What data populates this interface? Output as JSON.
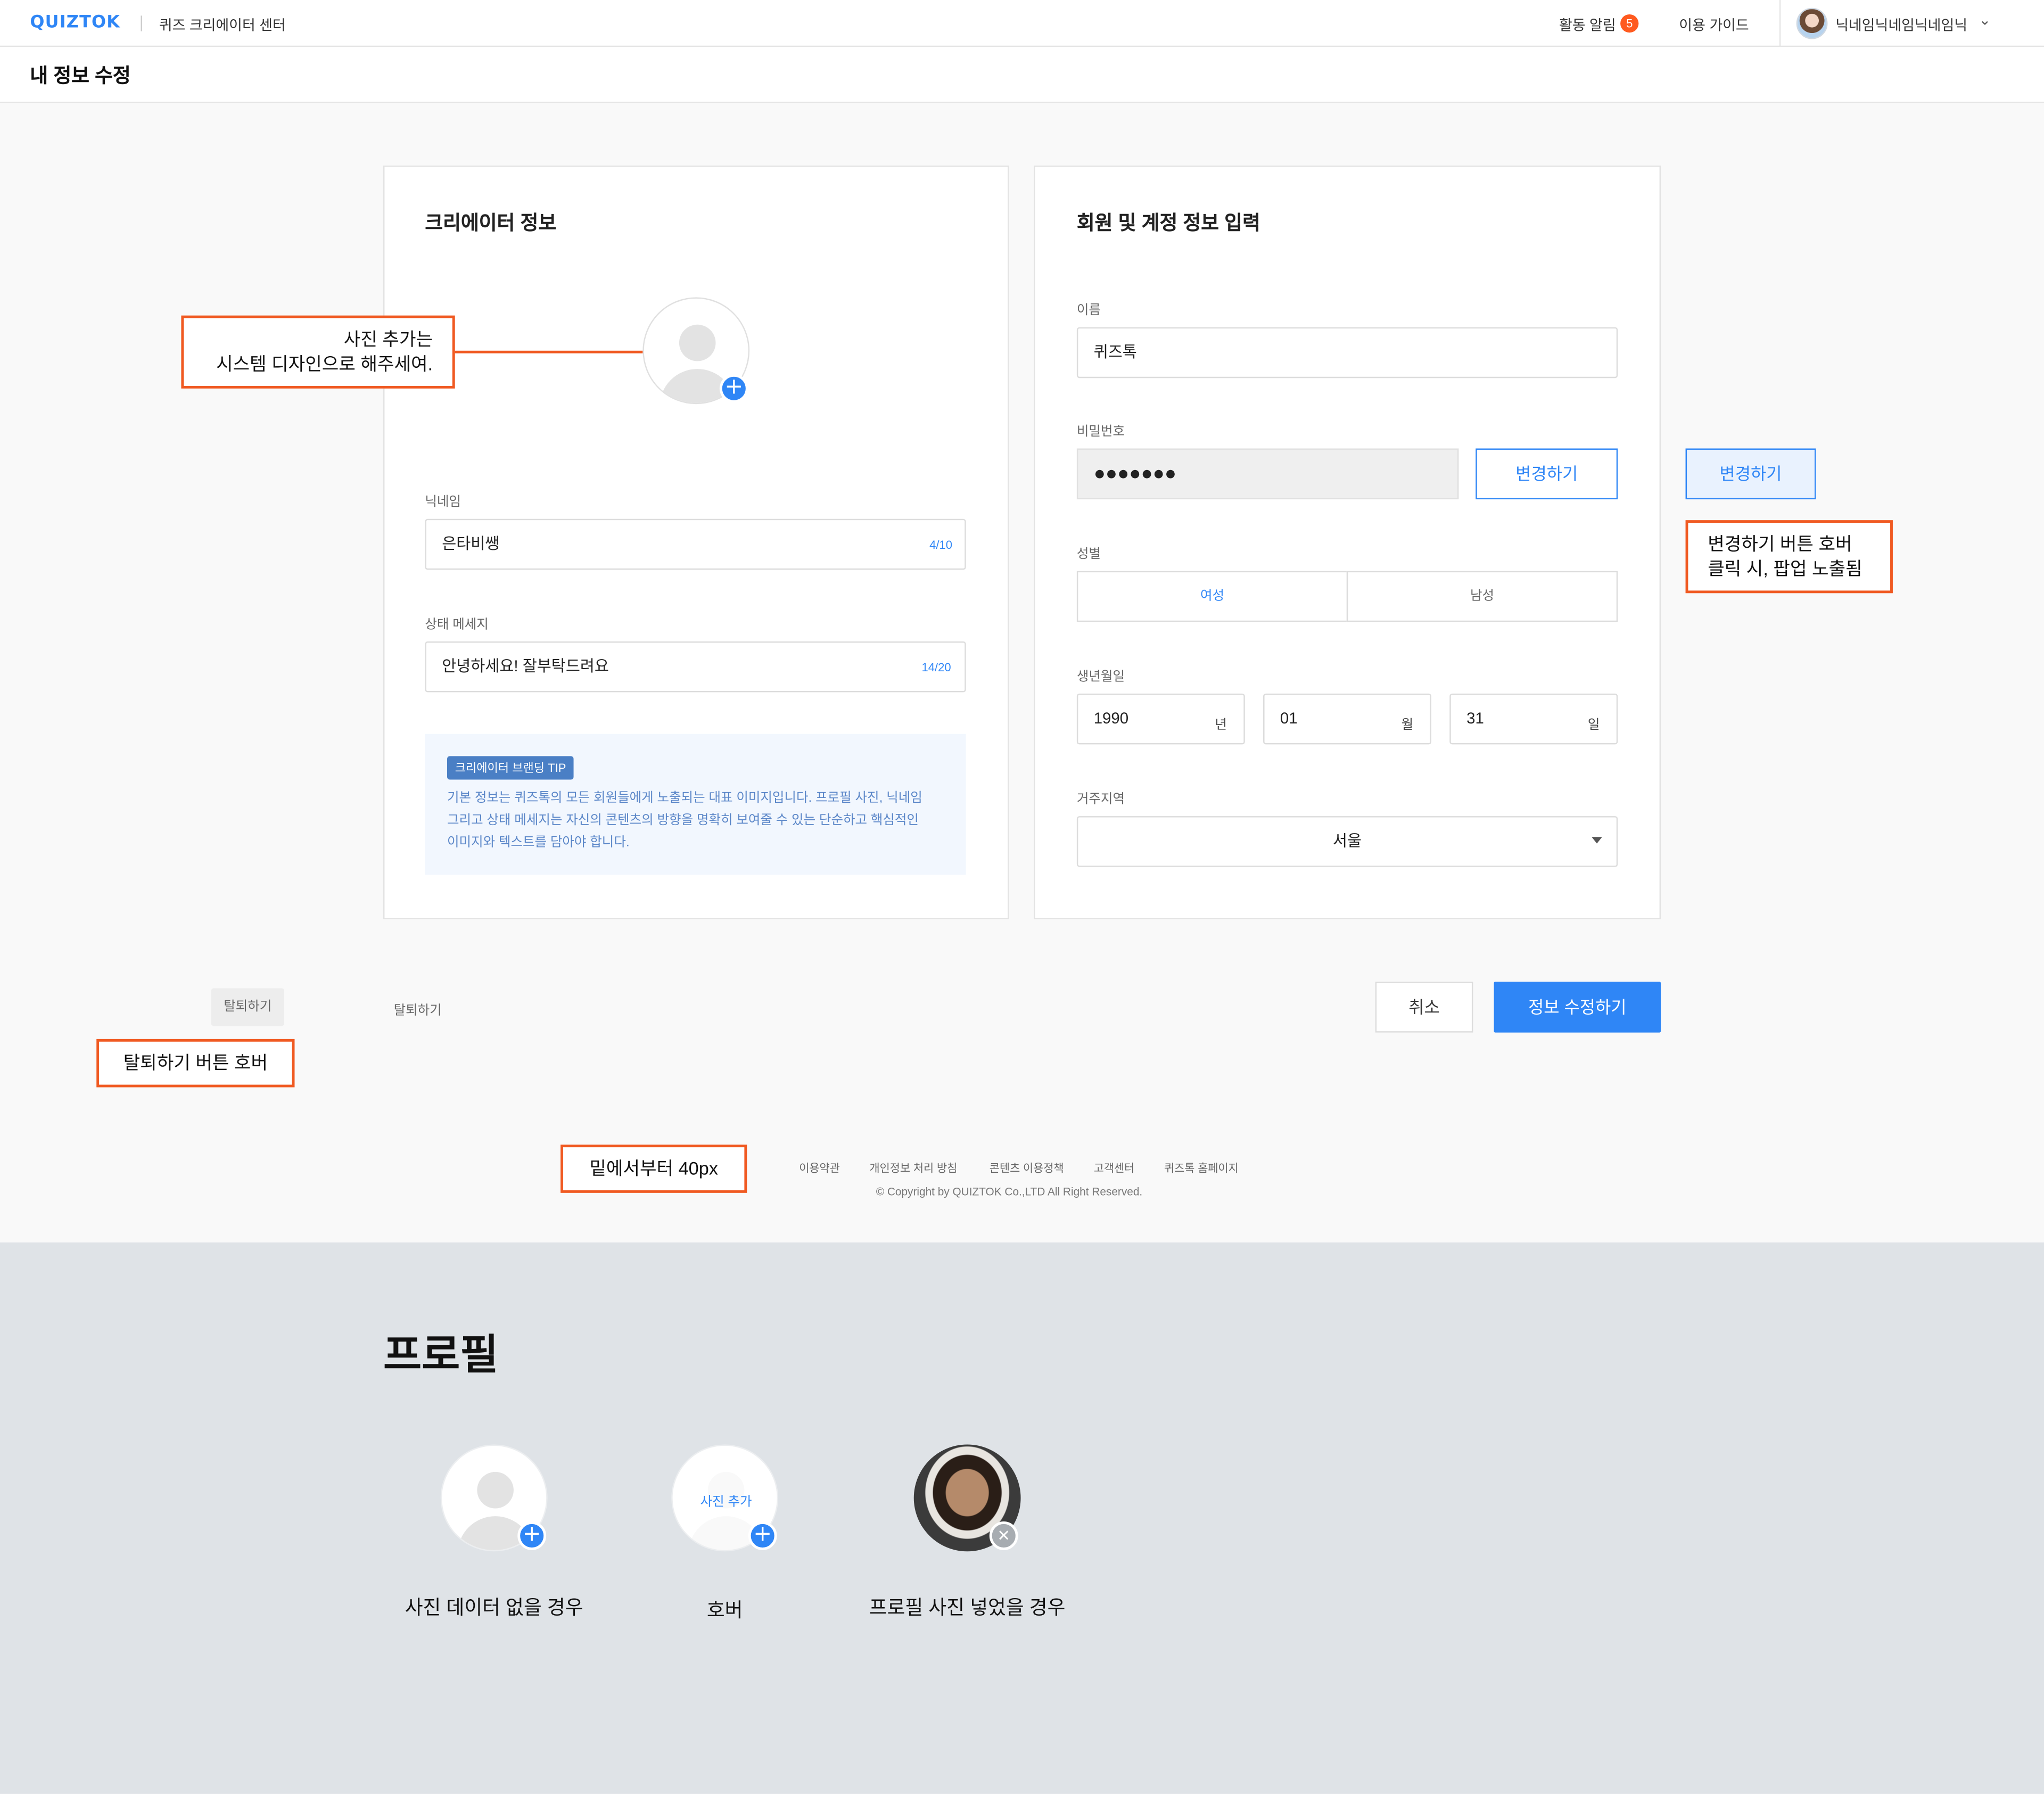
{
  "header": {
    "logo": "QUIZTOK",
    "center_name": "퀴즈 크리에이터 센터",
    "alarm_label": "활동 알림",
    "alarm_count": "5",
    "guide_label": "이용 가이드",
    "nickname": "닉네임닉네임닉네임닉"
  },
  "page": {
    "title": "내 정보 수정"
  },
  "creator_card": {
    "title": "크리에이터 정보",
    "nickname_label": "닉네임",
    "nickname_value": "은타비쌩",
    "nickname_count": "4/10",
    "status_label": "상태 메세지",
    "status_value": "안녕하세요! 잘부탁드려요",
    "status_count": "14/20",
    "tip_badge": "크리에이터 브랜딩 TIP",
    "tip_line1": "기본 정보는 퀴즈톡의 모든 회원들에게 노출되는 대표 이미지입니다. 프로필 사진, 닉네임",
    "tip_line2": "그리고 상태 메세지는 자신의 콘텐츠의 방향을 명확히 보여줄 수 있는 단순하고 핵심적인",
    "tip_line3": "이미지와 텍스트를 담아야 합니다."
  },
  "account_card": {
    "title": "회원 및 계정 정보 입력",
    "name_label": "이름",
    "name_value": "퀴즈톡",
    "password_label": "비밀번호",
    "password_value": "●●●●●●●",
    "change_button": "변경하기",
    "gender_label": "성별",
    "gender_female": "여성",
    "gender_male": "남성",
    "birth_label": "생년월일",
    "birth_year": "1990",
    "birth_year_unit": "년",
    "birth_month": "01",
    "birth_month_unit": "월",
    "birth_day": "31",
    "birth_day_unit": "일",
    "region_label": "거주지역",
    "region_value": "서울"
  },
  "annotations": {
    "photo_line1": "사진 추가는",
    "photo_line2": "시스템 디자인으로 해주세여.",
    "change_hover_button": "변경하기",
    "change_line1": "변경하기 버튼 호버",
    "change_line2": "클릭 시, 팝업 노출됨",
    "withdraw_note": "탈퇴하기 버튼 호버",
    "footer_note": "밑에서부터 40px"
  },
  "actions": {
    "withdraw_hover": "탈퇴하기",
    "withdraw": "탈퇴하기",
    "cancel": "취소",
    "submit": "정보 수정하기"
  },
  "footer": {
    "links": [
      "이용약관",
      "개인정보 처리 방침",
      "콘텐츠 이용정책",
      "고객센터",
      "퀴즈톡 홈페이지"
    ],
    "copyright": "© Copyright by QUIZTOK Co.,LTD All Right Reserved."
  },
  "profile_section": {
    "title": "프로필",
    "hover_text": "사진 추가",
    "state_empty": "사진 데이터 없을 경우",
    "state_hover": "호버",
    "state_photo": "프로필 사진 넣었을 경우"
  },
  "colors": {
    "accent": "#2f86f6",
    "annotation": "#f05a22",
    "badge": "#ff5a1f",
    "lower_bg": "#dfe3e7"
  }
}
